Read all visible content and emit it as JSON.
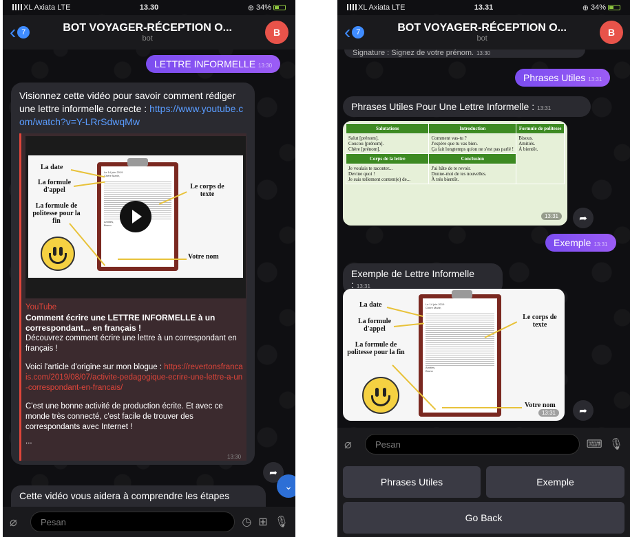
{
  "left": {
    "status": {
      "carrier": "XL Axiata LTE",
      "time": "13.30",
      "battery": "34%"
    },
    "header": {
      "title": "BOT VOYAGER-RÉCEPTION O...",
      "subtitle": "bot",
      "back_badge": "7",
      "avatar_letter": "B"
    },
    "msg_out_1": {
      "text": "LETTRE INFORMELLE",
      "time": "13:30"
    },
    "msg_in_1": {
      "text": "Visionnez cette vidéo pour savoir comment rédiger une lettre informelle correcte : ",
      "link": "https://www.youtube.com/watch?v=Y-LRrSdwqMw",
      "yt_source": "YouTube",
      "yt_title": "Comment écrire une LETTRE INFORMELLE à un correspondant... en français !",
      "yt_desc1": "Découvrez comment écrire une lettre à un correspondant en français !",
      "yt_desc2_prefix": "Voici l'article d'origine sur mon blogue : ",
      "yt_desc2_link": "https://revertonsfrancais.com/2019/08/07/activite-pedagogique-ecrire-une-lettre-a-un-correspondant-en-francais/",
      "yt_desc3": "C'est une bonne activité de production écrite. Et avec ce monde très connecté, c'est facile de trouver des correspondants avec Internet !",
      "yt_more": "...",
      "time": "13:30"
    },
    "msg_in_2": {
      "text": "Cette vidéo vous aidera à comprendre les étapes"
    },
    "input": {
      "placeholder": "Pesan"
    }
  },
  "right": {
    "status": {
      "carrier": "XL Axiata LTE",
      "time": "13.31",
      "battery": "34%"
    },
    "header": {
      "title": "BOT VOYAGER-RÉCEPTION O...",
      "subtitle": "bot",
      "back_badge": "7",
      "avatar_letter": "B"
    },
    "top_fragment": {
      "text": "Signature : Signez de votre prénom.",
      "time": "13:30"
    },
    "msg_out_1": {
      "text": "Phrases Utiles",
      "time": "13:31"
    },
    "msg_in_1": {
      "text": "Phrases Utiles Pour Une Lettre Informelle :",
      "time": "13:31"
    },
    "table": {
      "headers": [
        "Salutations",
        "Introduction",
        "Formule de politesse"
      ],
      "salutations": [
        "Salut [prénom].",
        "Coucou [prénom].",
        "Chère [prénom]."
      ],
      "introduction": [
        "Comment vas-tu ?",
        "J'espère que tu vas bien.",
        "Ça fait longtemps qu'on ne s'est pas parlé !"
      ],
      "politesse": [
        "Bisous.",
        "Amitiés.",
        "À bientôt."
      ],
      "headers2": [
        "Corps de la lettre",
        "Conclusion"
      ],
      "corps": [
        "Je voulais te raconter...",
        "Devine quoi !",
        "Je suis tellement content(e) de..."
      ],
      "conclusion": [
        "J'ai hâte de te revoir.",
        "Donne-moi de tes nouvelles.",
        "À très bientôt."
      ],
      "image_time": "13:31"
    },
    "msg_out_2": {
      "text": "Exemple",
      "time": "13:31"
    },
    "msg_in_2": {
      "text": "Exemple de Lettre Informelle :",
      "time": "13:31"
    },
    "example_time": "13:31",
    "input": {
      "placeholder": "Pesan"
    },
    "keyboard": {
      "btn1": "Phrases Utiles",
      "btn2": "Exemple",
      "btn3": "Go Back"
    }
  },
  "diagram": {
    "date": "La date",
    "appel": "La formule d'appel",
    "politesse": "La formule de politesse pour la fin",
    "corps": "Le corps de texte",
    "nom": "Votre nom",
    "letter_date": "Le 14 juin 2019",
    "letter_salut": "Chère Marie,",
    "letter_close": "Amitiés,",
    "letter_sign": "Bruno"
  }
}
